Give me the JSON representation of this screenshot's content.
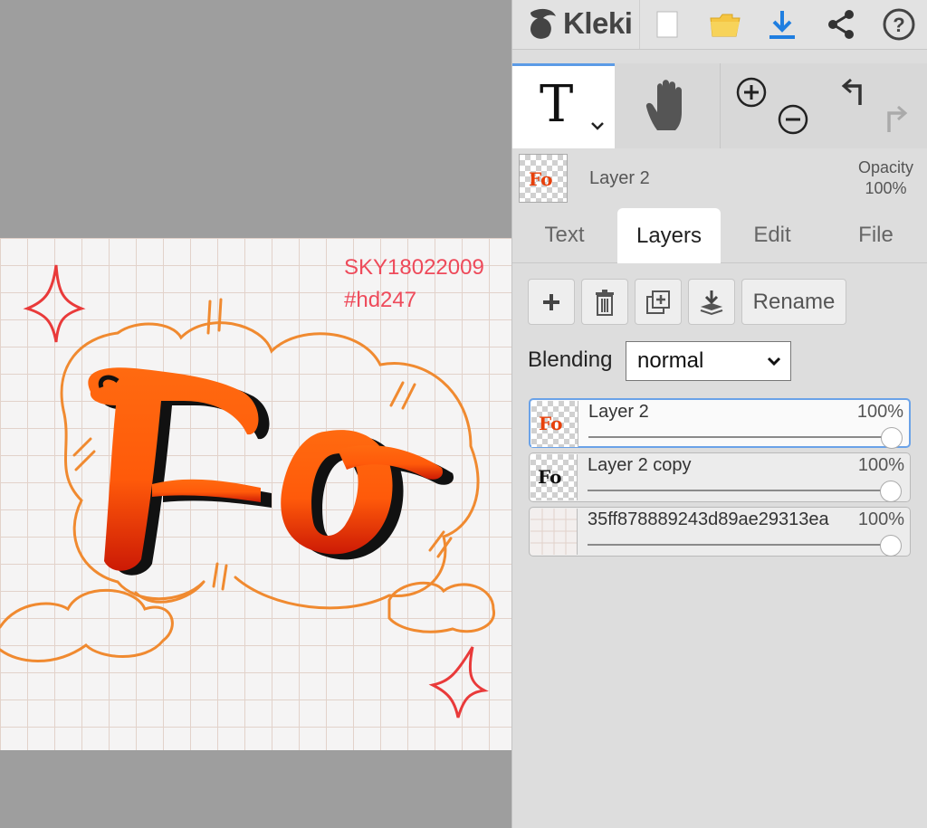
{
  "app": {
    "name": "Kleki"
  },
  "toolbar": {
    "new_icon": "file-icon",
    "open_icon": "folder-icon",
    "save_icon": "download-icon",
    "share_icon": "share-icon",
    "help_icon": "help-icon"
  },
  "tools": {
    "text_tool_glyph": "T",
    "hand_icon": "hand-icon",
    "zoom_in_icon": "zoom-in-icon",
    "zoom_out_icon": "zoom-out-icon",
    "undo_icon": "undo-icon",
    "redo_icon": "redo-icon"
  },
  "current_layer": {
    "name": "Layer 2",
    "opacity_label": "Opacity",
    "opacity_value": "100%"
  },
  "tabs": [
    {
      "label": "Text",
      "active": false
    },
    {
      "label": "Layers",
      "active": true
    },
    {
      "label": "Edit",
      "active": false
    },
    {
      "label": "File",
      "active": false
    }
  ],
  "layer_actions": {
    "add_icon": "plus-icon",
    "delete_icon": "trash-icon",
    "duplicate_icon": "duplicate-icon",
    "merge_icon": "merge-down-icon",
    "rename_label": "Rename"
  },
  "blending": {
    "label": "Blending",
    "value": "normal"
  },
  "layers": [
    {
      "name": "Layer 2",
      "opacity": "100%",
      "opacity_fraction": 1.0,
      "active": true
    },
    {
      "name": "Layer 2 copy",
      "opacity": "100%",
      "opacity_fraction": 1.0,
      "active": false
    },
    {
      "name": "35ff878889243d89ae29313ea",
      "opacity": "100%",
      "opacity_fraction": 1.0,
      "active": false
    }
  ],
  "artwork": {
    "watermark_line1": "SKY18022009",
    "watermark_line2": "#hd247",
    "lettering": "Fo",
    "colors": {
      "orange": "#f07a1f",
      "red": "#e83a3a",
      "grid": "#e8d8d0"
    }
  }
}
